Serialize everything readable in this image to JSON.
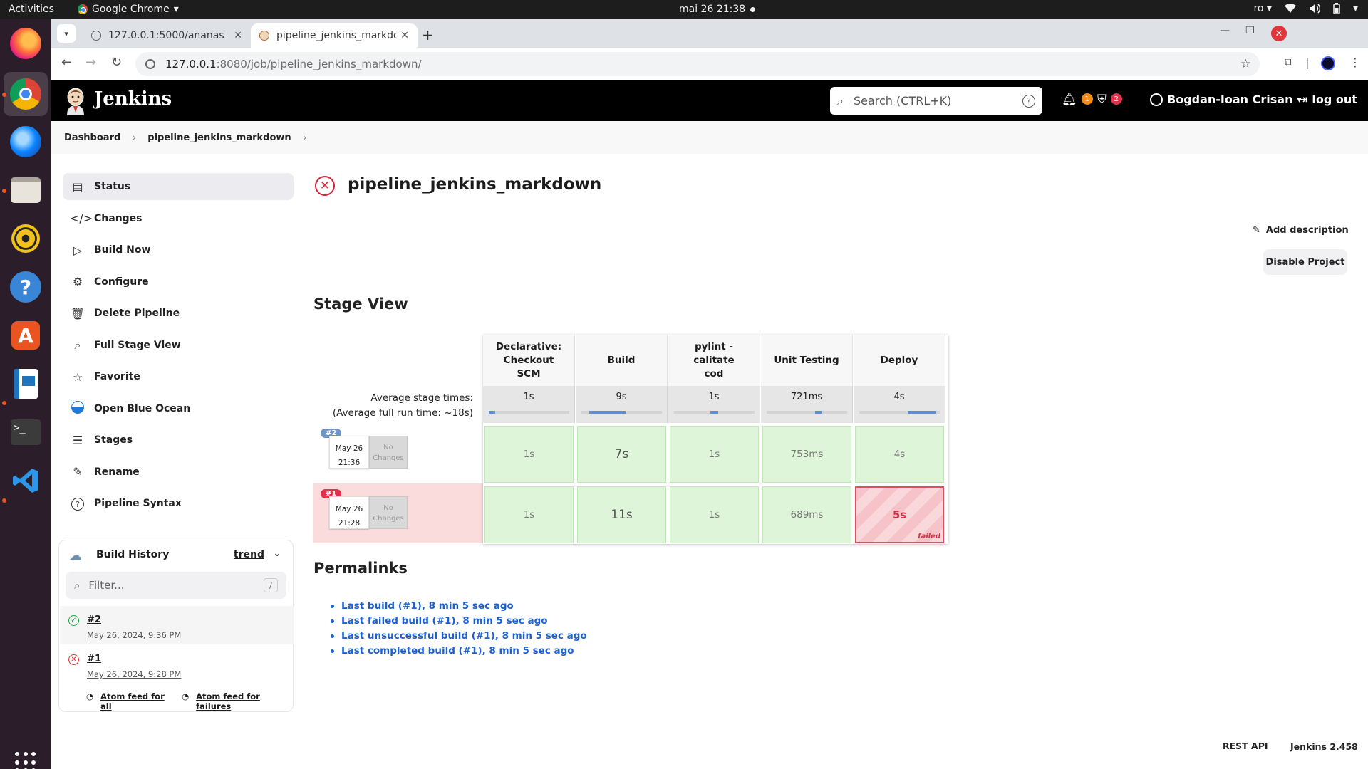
{
  "os_topbar": {
    "activities": "Activities",
    "app_name": "Google Chrome",
    "clock": "mai 26  21:38",
    "keyboard_layout": "ro"
  },
  "dock": {
    "icons": [
      "firefox-icon",
      "chrome-icon",
      "thunderbird-icon",
      "files-icon",
      "rhythmbox-icon",
      "help-icon",
      "app-center-icon",
      "writer-icon",
      "terminal-icon",
      "vscode-icon",
      "show-apps-icon"
    ]
  },
  "browser": {
    "tabs": [
      {
        "title": "127.0.0.1:5000/ananas",
        "active": false
      },
      {
        "title": "pipeline_jenkins_markdown",
        "active": true
      }
    ],
    "url_host": "127.0.0.1",
    "url_path": ":8080/job/pipeline_jenkins_markdown/"
  },
  "jenkins_header": {
    "brand": "Jenkins",
    "search_placeholder": "Search (CTRL+K)",
    "help_glyph": "?",
    "notifications_count": "1",
    "security_count": "2",
    "user_name": "Bogdan-Ioan Crisan",
    "logout": "log out"
  },
  "breadcrumb": {
    "items": [
      "Dashboard",
      "pipeline_jenkins_markdown"
    ]
  },
  "sidebar": {
    "items": [
      {
        "label": "Status",
        "icon": "status-icon"
      },
      {
        "label": "Changes",
        "icon": "code-icon"
      },
      {
        "label": "Build Now",
        "icon": "play-icon"
      },
      {
        "label": "Configure",
        "icon": "gear-icon"
      },
      {
        "label": "Delete Pipeline",
        "icon": "trash-icon"
      },
      {
        "label": "Full Stage View",
        "icon": "search-icon"
      },
      {
        "label": "Favorite",
        "icon": "star-icon"
      },
      {
        "label": "Open Blue Ocean",
        "icon": "blue-ocean-icon"
      },
      {
        "label": "Stages",
        "icon": "layers-icon"
      },
      {
        "label": "Rename",
        "icon": "pencil-icon"
      },
      {
        "label": "Pipeline Syntax",
        "icon": "help-circle-icon"
      }
    ]
  },
  "build_history": {
    "title": "Build History",
    "trend": "trend",
    "filter_placeholder": "Filter...",
    "filter_shortcut": "/",
    "builds": [
      {
        "number": "#2",
        "date": "May 26, 2024, 9:36 PM",
        "status": "success"
      },
      {
        "number": "#1",
        "date": "May 26, 2024, 9:28 PM",
        "status": "failed"
      }
    ],
    "feed_all": "Atom feed for all",
    "feed_failures": "Atom feed for failures"
  },
  "main": {
    "title": "pipeline_jenkins_markdown",
    "add_description": "Add description",
    "disable_project": "Disable Project",
    "stage_view_heading": "Stage View",
    "permalinks_heading": "Permalinks"
  },
  "stage_view": {
    "avg_label_line1": "Average stage times:",
    "avg_label_prefix": "(Average ",
    "avg_label_full": "full",
    "avg_label_suffix": " run time: ~18s)",
    "stages": [
      {
        "name": "Declarative: Checkout SCM",
        "avg": "1s"
      },
      {
        "name": "Build",
        "avg": "9s"
      },
      {
        "name": "pylint - calitate cod",
        "avg": "1s"
      },
      {
        "name": "Unit Testing",
        "avg": "721ms"
      },
      {
        "name": "Deploy",
        "avg": "4s"
      }
    ],
    "runs": [
      {
        "number": "#2",
        "date": "May 26",
        "time": "21:36",
        "changes": "No Changes",
        "status": "success",
        "cells": [
          "1s",
          "7s",
          "1s",
          "753ms",
          "4s"
        ],
        "failed_index": -1
      },
      {
        "number": "#1",
        "date": "May 26",
        "time": "21:28",
        "changes": "No Changes",
        "status": "failed",
        "cells": [
          "1s",
          "11s",
          "1s",
          "689ms",
          "5s"
        ],
        "failed_index": 4
      }
    ],
    "failed_label": "failed"
  },
  "permalinks": [
    "Last build (#1), 8 min 5 sec ago",
    "Last failed build (#1), 8 min 5 sec ago",
    "Last unsuccessful build (#1), 8 min 5 sec ago",
    "Last completed build (#1), 8 min 5 sec ago"
  ],
  "footer": {
    "rest_api": "REST API",
    "version": "Jenkins 2.458"
  },
  "colors": {
    "jenkins_header_bg": "#000000",
    "failed_red": "#d2263a",
    "success_green": "#dff5d9",
    "link_blue": "#1c5fcf"
  }
}
